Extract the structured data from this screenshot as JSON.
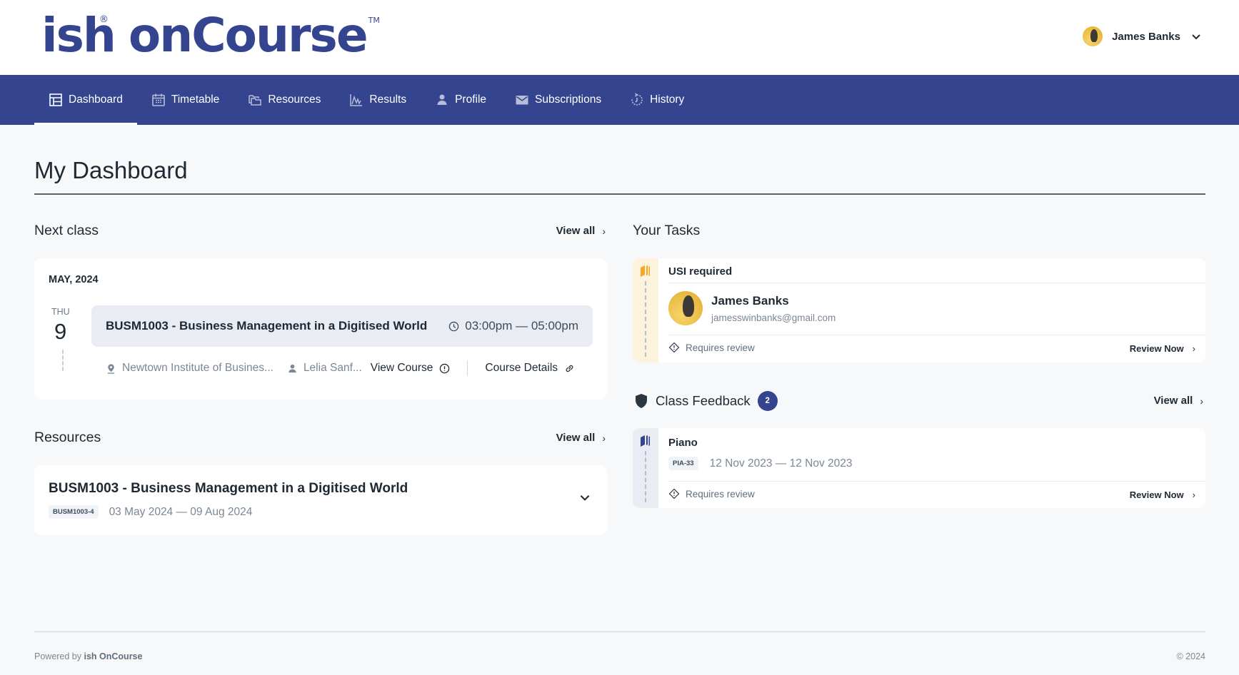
{
  "header": {
    "logo_text": "ish onCourse",
    "logo_part1": "ish",
    "logo_part2": "onCourse",
    "logo_reg": "®",
    "logo_tm": "TM",
    "user_name": "James Banks"
  },
  "nav": {
    "items": [
      {
        "label": "Dashboard",
        "icon": "dashboard-icon",
        "active": true
      },
      {
        "label": "Timetable",
        "icon": "calendar-icon",
        "active": false
      },
      {
        "label": "Resources",
        "icon": "folders-icon",
        "active": false
      },
      {
        "label": "Results",
        "icon": "chart-icon",
        "active": false
      },
      {
        "label": "Profile",
        "icon": "user-icon",
        "active": false
      },
      {
        "label": "Subscriptions",
        "icon": "mail-icon",
        "active": false
      },
      {
        "label": "History",
        "icon": "history-icon",
        "active": false
      }
    ]
  },
  "page": {
    "title": "My Dashboard"
  },
  "next_class": {
    "section_title": "Next class",
    "view_all": "View all",
    "month": "MAY, 2024",
    "day_of_week": "THU",
    "day": "9",
    "course_title": "BUSM1003 - Business Management in a Digitised World",
    "time": "03:00pm — 05:00pm",
    "location": "Newtown Institute of Busines...",
    "tutor": "Lelia Sanf...",
    "view_course": "View Course",
    "course_details": "Course Details"
  },
  "resources": {
    "section_title": "Resources",
    "view_all": "View all",
    "items": [
      {
        "title": "BUSM1003 - Business Management in a Digitised World",
        "code": "BUSM1003-4",
        "dates": "03 May 2024 — 09 Aug 2024"
      }
    ]
  },
  "tasks": {
    "section_title": "Your Tasks",
    "items": [
      {
        "title": "USI required",
        "user_name": "James Banks",
        "email": "jamesswinbanks@gmail.com",
        "status": "Requires review",
        "action": "Review Now",
        "accent": "#f5a623",
        "rail_bg": "#fdf3dc"
      }
    ]
  },
  "class_feedback": {
    "section_title": "Class Feedback",
    "count": "2",
    "view_all": "View all",
    "items": [
      {
        "title": "Piano",
        "code": "PIA-33",
        "dates": "12 Nov 2023 — 12 Nov 2023",
        "status": "Requires review",
        "action": "Review Now",
        "accent": "#34448f",
        "rail_bg": "#e9ecf3"
      }
    ]
  },
  "footer": {
    "powered_prefix": "Powered by",
    "powered_brand": "ish OnCourse",
    "copyright": "© 2024"
  },
  "colors": {
    "brand": "#34448f",
    "background": "#f7f8fa",
    "task_accent": "#f5a623"
  }
}
